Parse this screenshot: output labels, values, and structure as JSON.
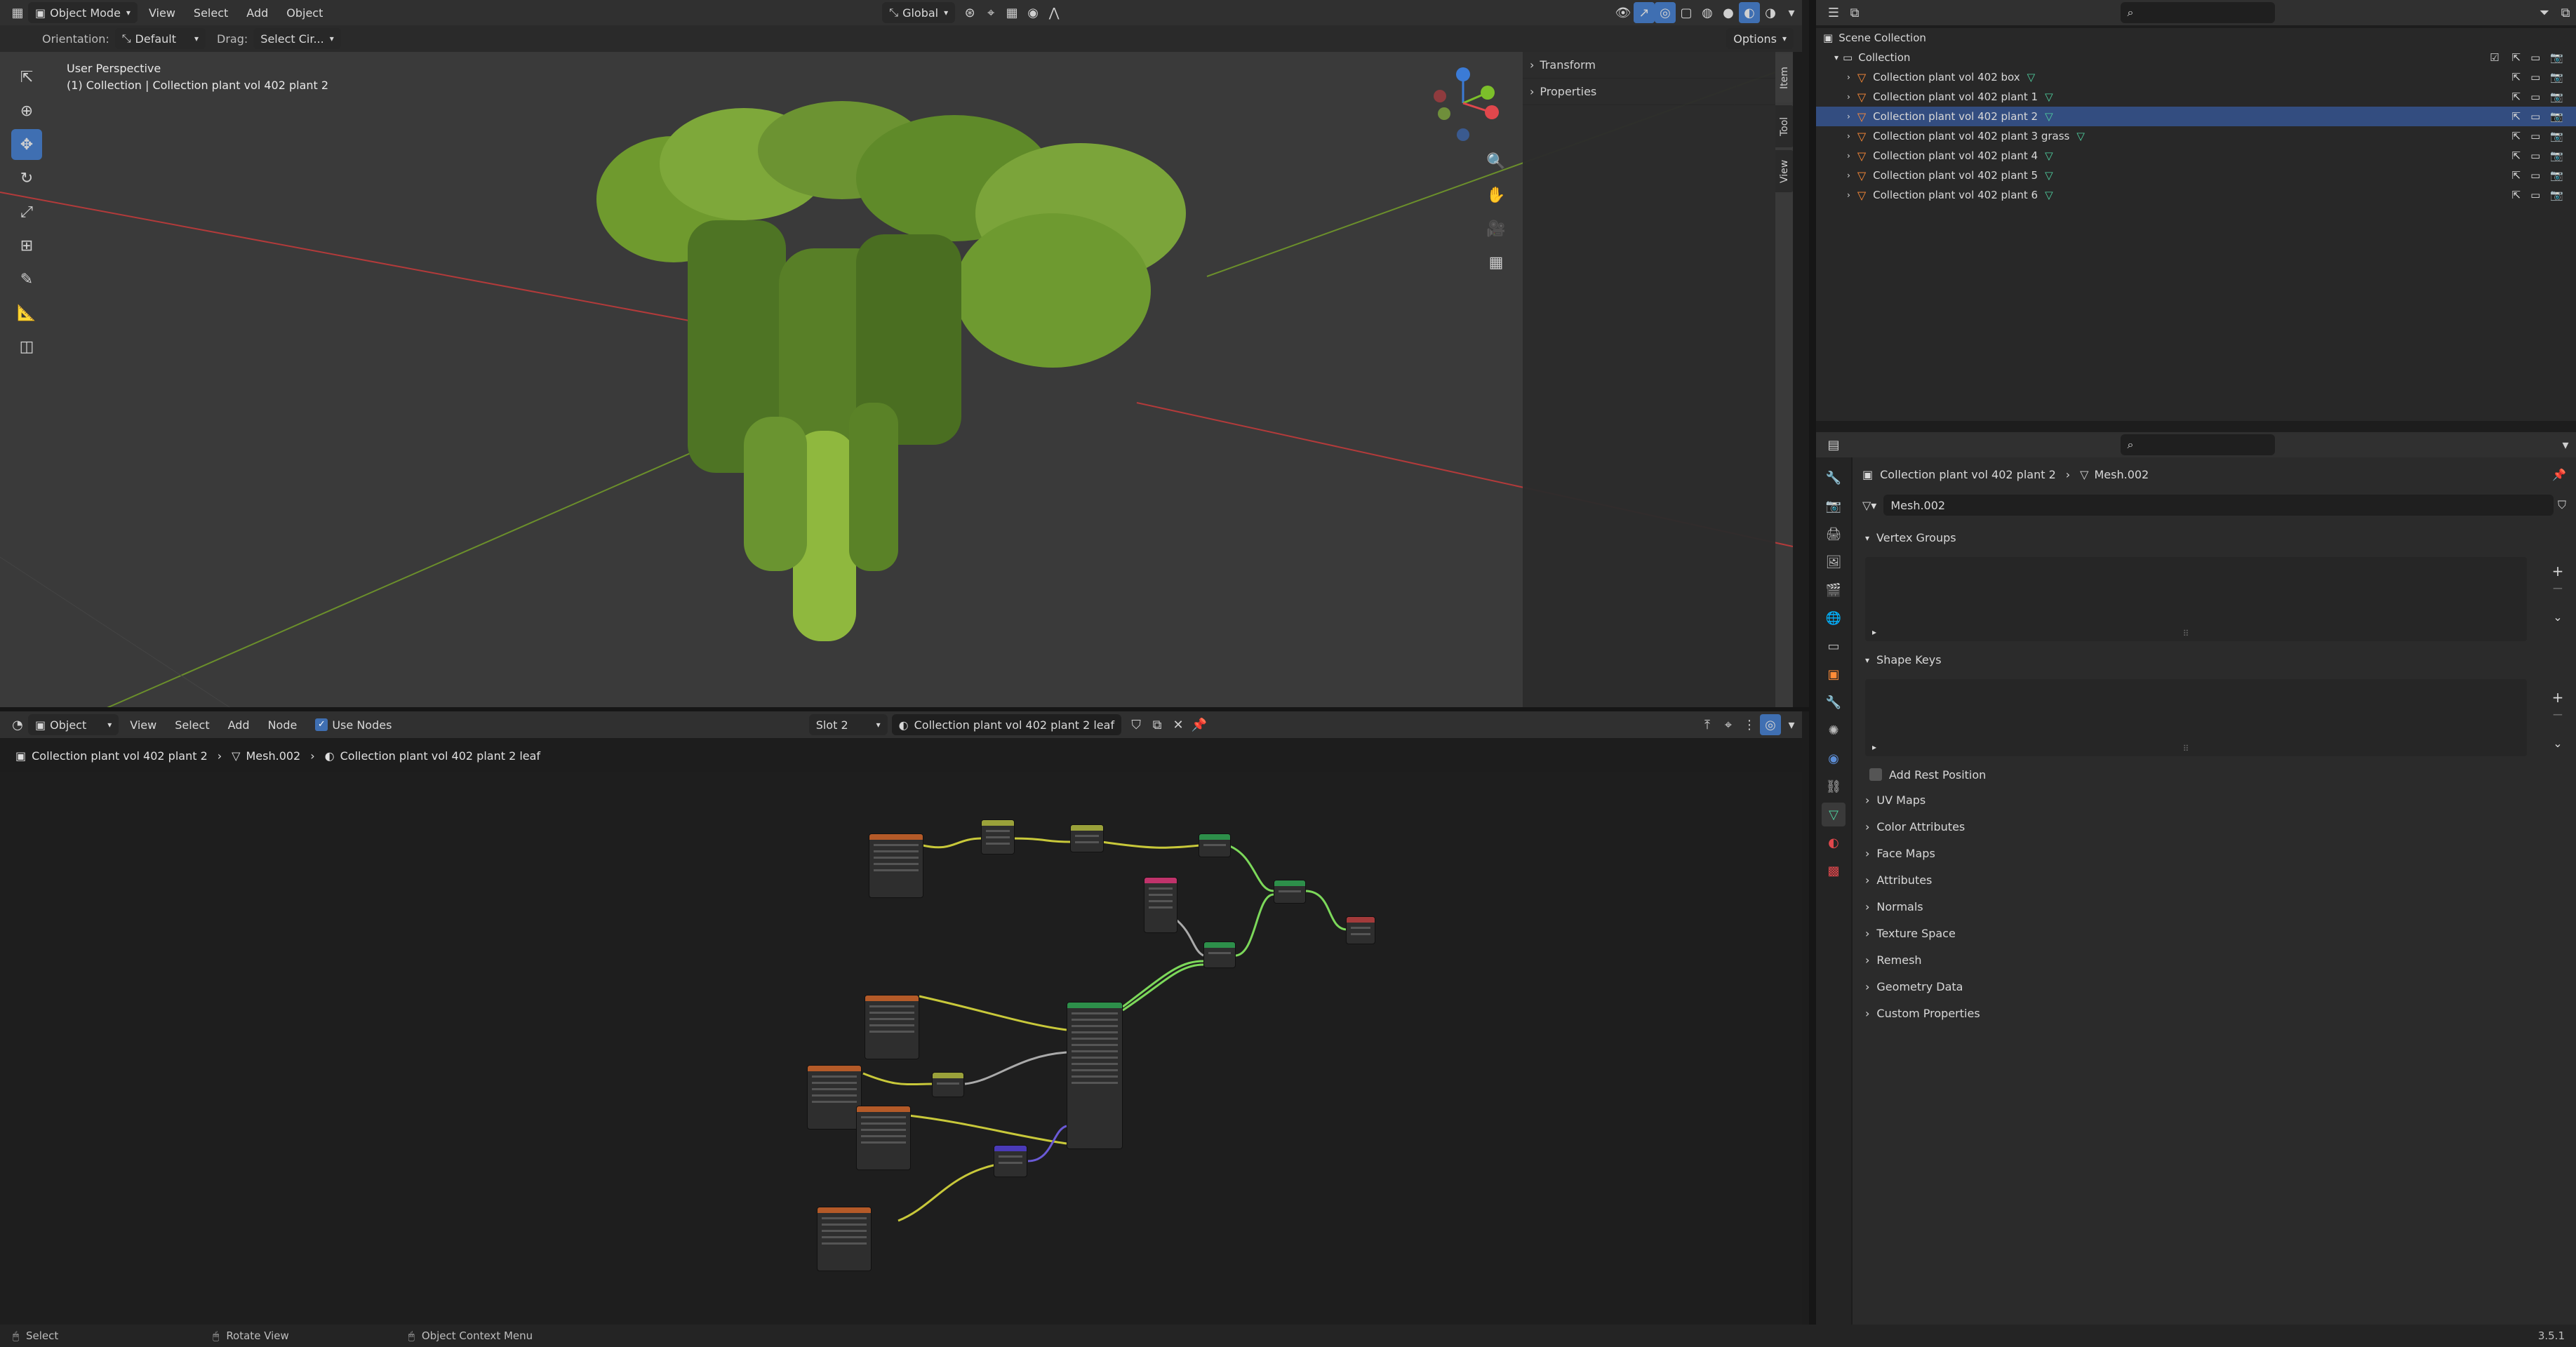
{
  "viewport_header": {
    "mode": "Object Mode",
    "menus": [
      "View",
      "Select",
      "Add",
      "Object"
    ],
    "transform_orientation": "Global",
    "options_label": "Options"
  },
  "tool_settings": {
    "orientation_label": "Orientation:",
    "orientation_value": "Default",
    "drag_label": "Drag:",
    "drag_value": "Select Cir..."
  },
  "viewport": {
    "perspective": "User Perspective",
    "collection_info": "(1) Collection | Collection plant vol 402 plant 2",
    "sidebar_panels": [
      "Transform",
      "Properties"
    ],
    "sidebar_tabs": [
      "Item",
      "Tool",
      "View"
    ],
    "gizmo_axes": [
      "Z",
      "Y",
      "X"
    ]
  },
  "node_editor_header": {
    "type": "Object",
    "menus": [
      "View",
      "Select",
      "Add",
      "Node"
    ],
    "use_nodes_label": "Use Nodes",
    "use_nodes_checked": true,
    "slot": "Slot 2",
    "material": "Collection plant vol 402 plant 2 leaf"
  },
  "node_breadcrumb": {
    "object": "Collection plant vol 402 plant 2",
    "mesh": "Mesh.002",
    "material": "Collection plant vol 402 plant 2 leaf"
  },
  "outliner": {
    "root": "Scene Collection",
    "collection": "Collection",
    "items": [
      {
        "label": "Collection plant vol 402 box",
        "selected": false
      },
      {
        "label": "Collection plant vol 402 plant 1",
        "selected": false
      },
      {
        "label": "Collection plant vol 402 plant 2",
        "selected": true
      },
      {
        "label": "Collection plant vol 402 plant 3 grass",
        "selected": false
      },
      {
        "label": "Collection plant vol 402 plant 4",
        "selected": false
      },
      {
        "label": "Collection plant vol 402 plant 5",
        "selected": false
      },
      {
        "label": "Collection plant vol 402 plant 6",
        "selected": false
      }
    ]
  },
  "properties": {
    "breadcrumb_object": "Collection plant vol 402 plant 2",
    "breadcrumb_mesh": "Mesh.002",
    "mesh_name": "Mesh.002",
    "vertex_groups": "Vertex Groups",
    "shape_keys": "Shape Keys",
    "add_rest_position": "Add Rest Position",
    "collapsed_panels": [
      "UV Maps",
      "Color Attributes",
      "Face Maps",
      "Attributes",
      "Normals",
      "Texture Space",
      "Remesh",
      "Geometry Data",
      "Custom Properties"
    ]
  },
  "status_bar": {
    "select": "Select",
    "rotate": "Rotate View",
    "context_menu": "Object Context Menu",
    "version": "3.5.1"
  },
  "colors": {
    "accent": "#3f6fb2",
    "selected_row": "#334d80",
    "mesh_triangle": "#ff8c38",
    "data_green": "#4fd1a0"
  }
}
